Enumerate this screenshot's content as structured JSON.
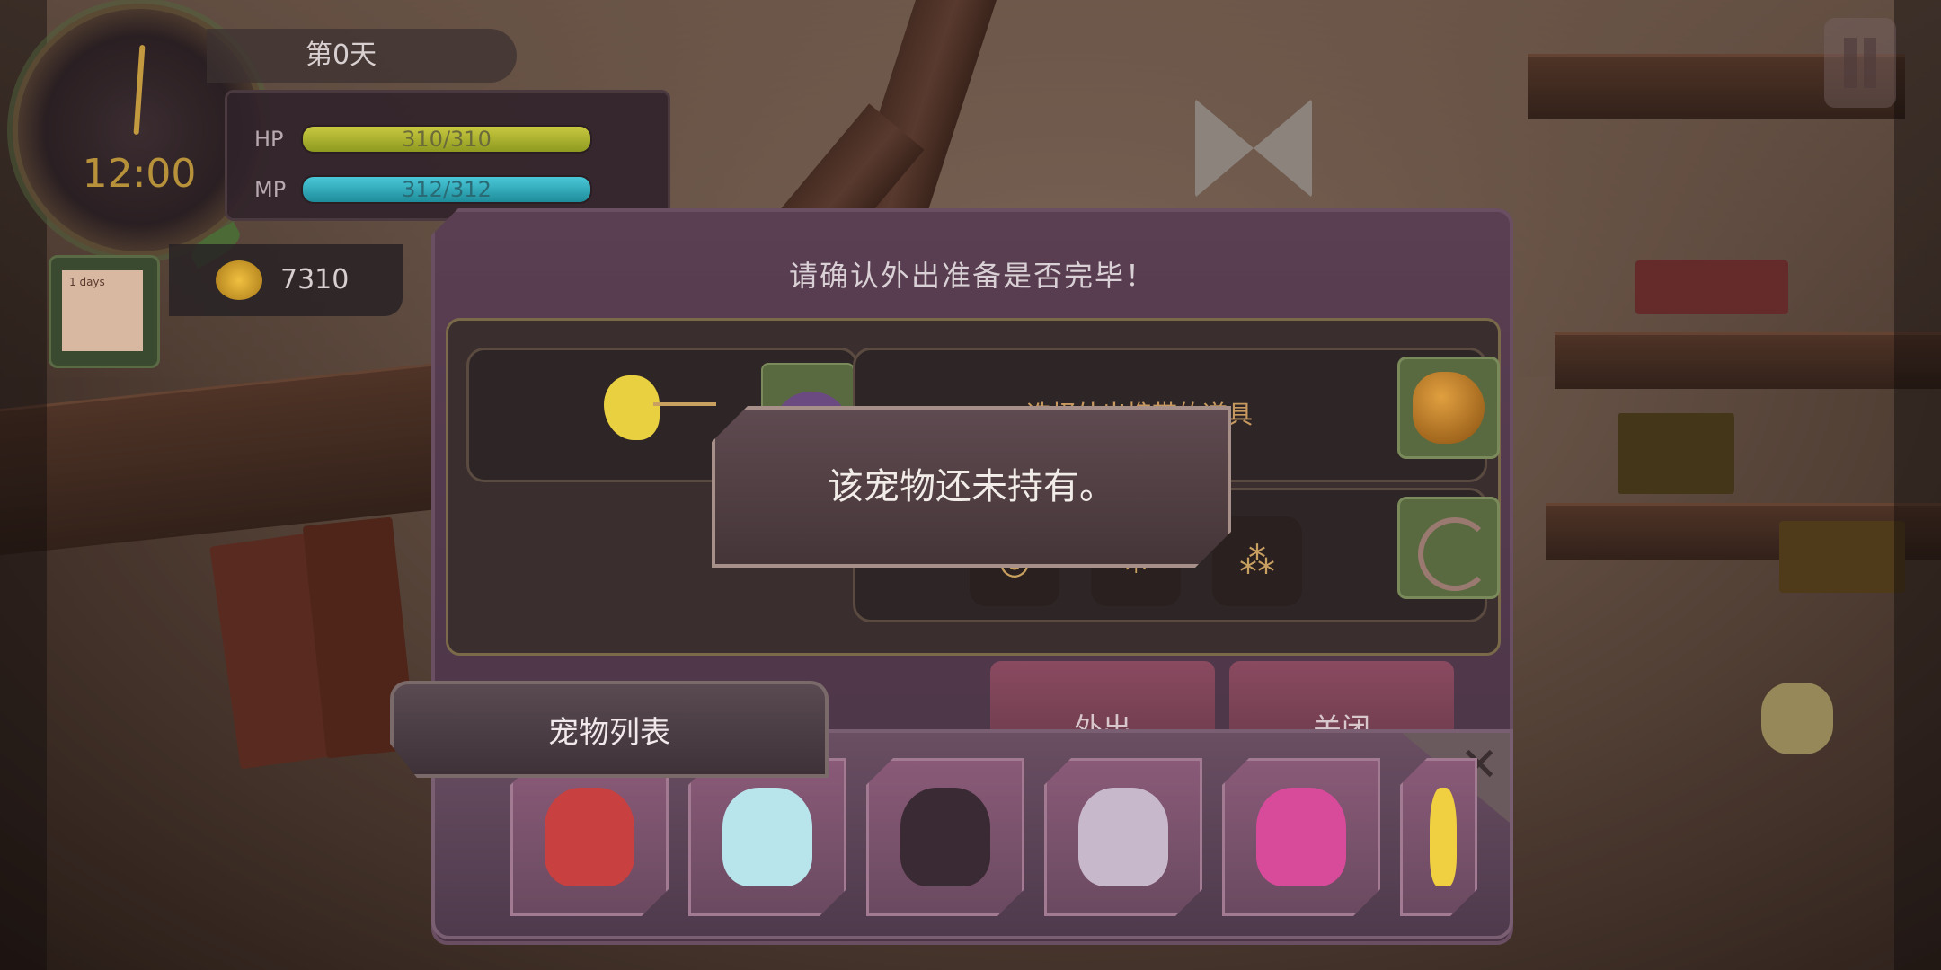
{
  "hud": {
    "day": "第0天",
    "clock_time": "12:00",
    "hp_label": "HP",
    "hp_value": "310/310",
    "mp_label": "MP",
    "mp_value": "312/312",
    "gold": "7310",
    "note_text": "1 days"
  },
  "dialog": {
    "title": "请确认外出准备是否完毕！",
    "item_hint": "选择外出携带的道具",
    "go_out_button": "外出",
    "close_button": "关闭"
  },
  "toast": {
    "message": "该宠物还未持有。"
  },
  "pet_list": {
    "title": "宠物列表",
    "pets": [
      {
        "name": "red-dragon",
        "color": "#c84040"
      },
      {
        "name": "ice-spirit",
        "color": "#b8e4ec"
      },
      {
        "name": "shadow-bat",
        "color": "#3a2a34"
      },
      {
        "name": "white-bat",
        "color": "#c8b8cc"
      },
      {
        "name": "pink-cat",
        "color": "#d84a9a"
      },
      {
        "name": "yellow-bird",
        "color": "#f0d040"
      }
    ]
  },
  "colors": {
    "hp_bar": "#b8bc30",
    "mp_bar": "#2eb0c0",
    "dialog_bg": "#4e3848",
    "button_bg": "#7a4255"
  }
}
